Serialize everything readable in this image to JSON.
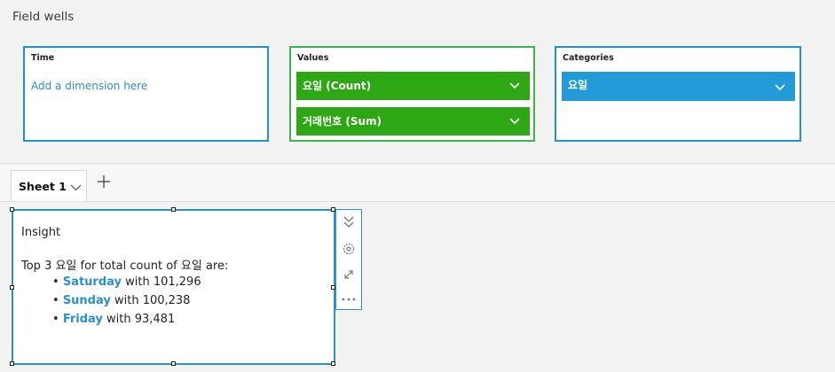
{
  "field_wells": {
    "title": "Field wells",
    "time": {
      "label": "Time",
      "placeholder": "Add a dimension here"
    },
    "values": {
      "label": "Values",
      "fields": [
        {
          "label": "요일 (Count)",
          "icon": "chevron-down-icon"
        },
        {
          "label": "거래번호 (Sum)",
          "icon": "chevron-down-icon"
        }
      ]
    },
    "categories": {
      "label": "Categories",
      "fields": [
        {
          "label": "요일",
          "icon": "chevron-down-icon"
        }
      ]
    }
  },
  "sheets": {
    "tabs": [
      {
        "label": "Sheet 1",
        "active": true
      }
    ],
    "add_icon": "plus-icon"
  },
  "visual": {
    "title": "Insight",
    "summary": "Top 3 요일 for total count of 요일 are:",
    "items": [
      {
        "name": "Saturday",
        "suffix": " with 101,296"
      },
      {
        "name": "Sunday",
        "suffix": " with 100,238"
      },
      {
        "name": "Friday",
        "suffix": " with 93,481"
      }
    ],
    "toolbar": [
      "collapse-icon",
      "gear-icon",
      "expand-icon",
      "more-icon"
    ]
  },
  "colors": {
    "accent_blue": "#229bd8",
    "accent_green": "#2ea714",
    "link": "#2a8fcf"
  }
}
